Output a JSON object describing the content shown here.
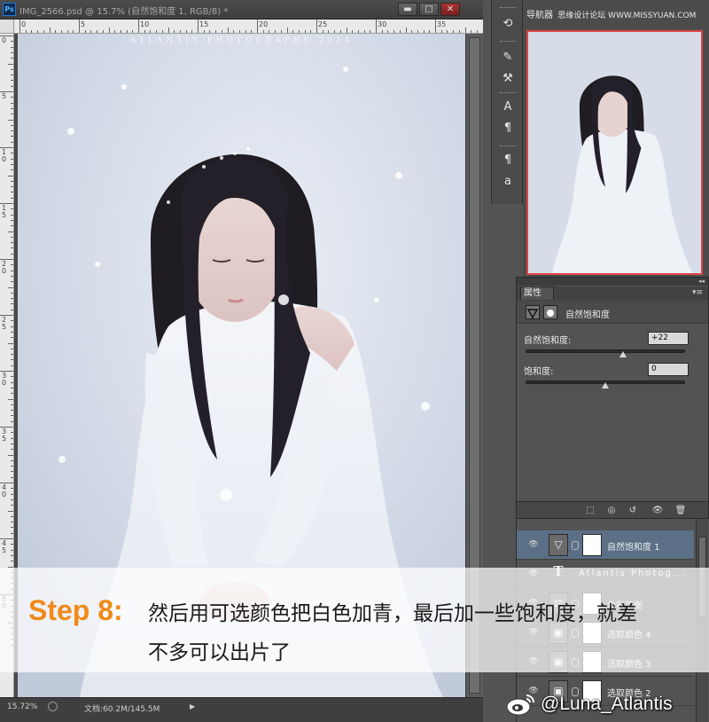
{
  "document": {
    "title": "IMG_2566.psd @ 15.7% (自然饱和度 1, RGB/8) *",
    "ps_logo": "Ps",
    "window_buttons": {
      "minimize": "▬",
      "restore": "□",
      "close": "✕"
    },
    "ruler_h_labels": [
      "0",
      "5",
      "10",
      "15",
      "20",
      "25",
      "30",
      "35"
    ],
    "ruler_v_labels": [
      "0",
      "5",
      "1 0",
      "1 5",
      "2 0",
      "2 5",
      "3 0",
      "3 5",
      "4 0",
      "4 5",
      "5 0"
    ],
    "photo_caption": "ATLANTIS PHOTOGRAPHY 2014",
    "status": {
      "zoom": "15.72%",
      "doc_info": "文档:60.2M/145.5M",
      "arrow": "▶"
    }
  },
  "iconstrip": {
    "icons": [
      {
        "name": "history-icon",
        "glyph": "⟲"
      },
      {
        "name": "brush-preset-icon",
        "glyph": "✎"
      },
      {
        "name": "tool-preset-icon",
        "glyph": "⚒"
      },
      {
        "name": "character-icon",
        "glyph": "A"
      },
      {
        "name": "paragraph-icon",
        "glyph": "¶"
      },
      {
        "name": "para-style-icon",
        "glyph": "¶"
      },
      {
        "name": "char-style-icon",
        "glyph": "a"
      }
    ]
  },
  "navigator": {
    "title": "导航器",
    "watermark": "思缘设计论坛 WWW.MISSYUAN.COM"
  },
  "properties": {
    "tab": "属性",
    "collapse": "◂◂",
    "menu": "▾≡",
    "adjustment_name": "自然饱和度",
    "fields": [
      {
        "label": "自然饱和度:",
        "value": "+22",
        "slider_pct": 61
      },
      {
        "label": "饱和度:",
        "value": "0",
        "slider_pct": 50
      }
    ],
    "bottom_icons": [
      "⬚",
      "◎",
      "↺",
      "👁",
      "🗑"
    ]
  },
  "layers": {
    "rows": [
      {
        "name": "自然饱和度 1",
        "thumb": "▽",
        "active": true,
        "type": "adjust"
      },
      {
        "name": "Atlantis Photog...",
        "thumb": "T",
        "active": false,
        "type": "text"
      },
      {
        "name": "色彩平衡",
        "thumb": "⚖",
        "active": false,
        "type": "adjust"
      },
      {
        "name": "选取颜色 4",
        "thumb": "▣",
        "active": false,
        "type": "adjust"
      },
      {
        "name": "选取颜色 3",
        "thumb": "▣",
        "active": false,
        "type": "adjust"
      },
      {
        "name": "选取颜色 2",
        "thumb": "▣",
        "active": false,
        "type": "adjust"
      }
    ],
    "eye": "👁"
  },
  "overlay": {
    "step": "Step 8:",
    "line1": "然后用可选颜色把白色加青，最后加一些饱和度，就差",
    "line2": "不多可以出片了"
  },
  "weibo": {
    "handle": "@Luna_Atlantis"
  },
  "colors": {
    "accent_orange": "#f08a1a",
    "active_layer": "#5b6f86",
    "nav_border": "#dd4444"
  }
}
